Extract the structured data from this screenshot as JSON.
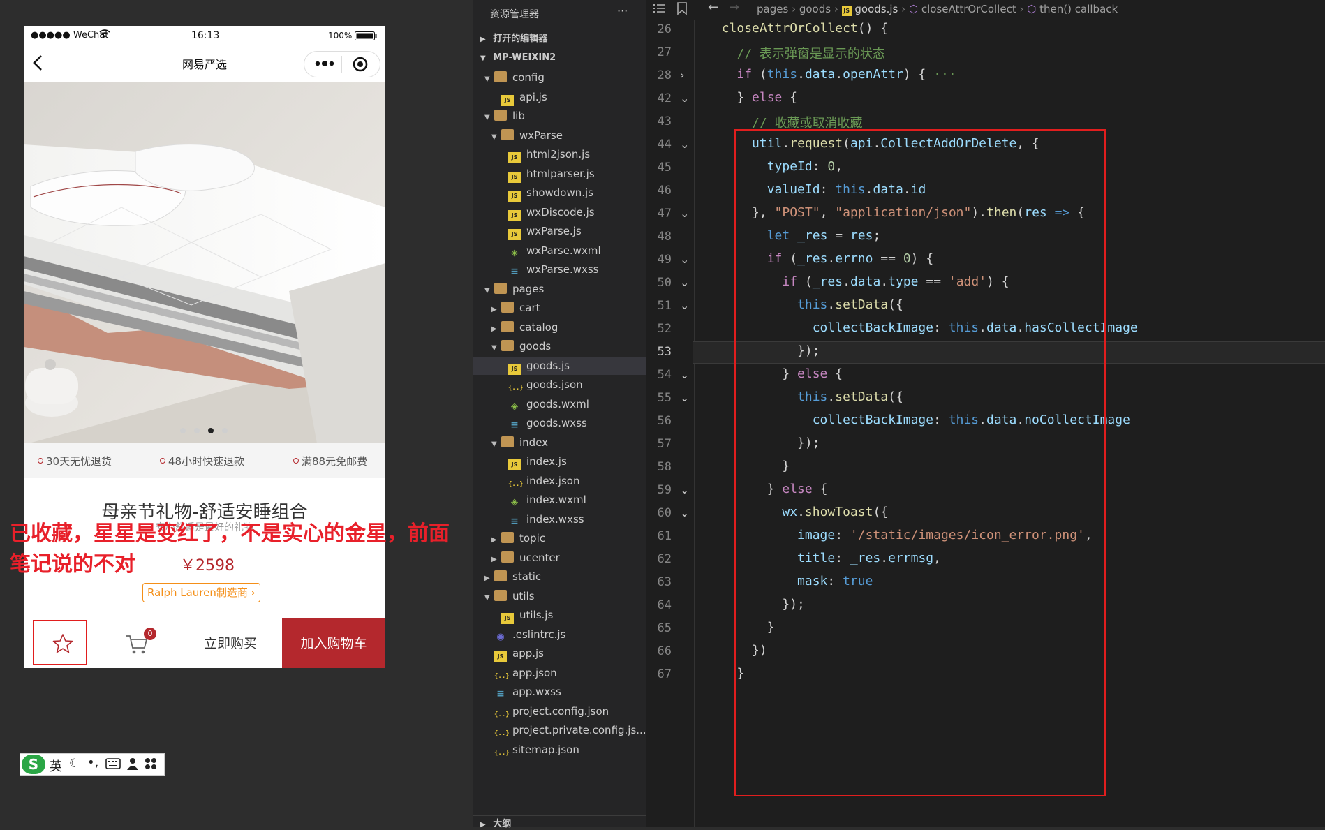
{
  "phone": {
    "carrier": "●●●●● WeChat",
    "time": "16:13",
    "battery": "100%",
    "nav_title": "网易严选",
    "services": [
      "30天无忧退货",
      "48小时快速退款",
      "满88元免邮费"
    ],
    "product_title": "母亲节礼物-舒适安睡组合",
    "product_subtitle": "安心舒适是最好的礼物",
    "price": "￥2598",
    "brand_tag": "Ralph Lauren制造商",
    "cart_badge": "0",
    "buy_now": "立即购买",
    "add_to_cart": "加入购物车",
    "carousel_active_index": 2
  },
  "annotation": {
    "line1": "已收藏，星星是变红了，不是实心的金星，前面",
    "line2": "笔记说的不对"
  },
  "ime_toolbar": {
    "lang": "英"
  },
  "explorer": {
    "header": "资源管理器",
    "more": "···",
    "open_editors": "打开的编辑器",
    "project": "MP-WEIXIN2",
    "outline": "大纲",
    "tree": [
      {
        "name": "config",
        "type": "folder",
        "depth": 1,
        "open": true
      },
      {
        "name": "api.js",
        "type": "js",
        "depth": 2
      },
      {
        "name": "lib",
        "type": "folder",
        "depth": 1,
        "open": true
      },
      {
        "name": "wxParse",
        "type": "folder",
        "depth": 2,
        "open": true
      },
      {
        "name": "html2json.js",
        "type": "js",
        "depth": 3
      },
      {
        "name": "htmlparser.js",
        "type": "js",
        "depth": 3
      },
      {
        "name": "showdown.js",
        "type": "js",
        "depth": 3
      },
      {
        "name": "wxDiscode.js",
        "type": "js",
        "depth": 3
      },
      {
        "name": "wxParse.js",
        "type": "js",
        "depth": 3
      },
      {
        "name": "wxParse.wxml",
        "type": "wxml",
        "depth": 3
      },
      {
        "name": "wxParse.wxss",
        "type": "css",
        "depth": 3
      },
      {
        "name": "pages",
        "type": "folder",
        "depth": 1,
        "open": true
      },
      {
        "name": "cart",
        "type": "folder",
        "depth": 2,
        "open": false
      },
      {
        "name": "catalog",
        "type": "folder",
        "depth": 2,
        "open": false
      },
      {
        "name": "goods",
        "type": "folder",
        "depth": 2,
        "open": true
      },
      {
        "name": "goods.js",
        "type": "js",
        "depth": 3,
        "selected": true
      },
      {
        "name": "goods.json",
        "type": "json",
        "depth": 3
      },
      {
        "name": "goods.wxml",
        "type": "wxml",
        "depth": 3
      },
      {
        "name": "goods.wxss",
        "type": "css",
        "depth": 3
      },
      {
        "name": "index",
        "type": "folder",
        "depth": 2,
        "open": true
      },
      {
        "name": "index.js",
        "type": "js",
        "depth": 3
      },
      {
        "name": "index.json",
        "type": "json",
        "depth": 3
      },
      {
        "name": "index.wxml",
        "type": "wxml",
        "depth": 3
      },
      {
        "name": "index.wxss",
        "type": "css",
        "depth": 3
      },
      {
        "name": "topic",
        "type": "folder",
        "depth": 2,
        "open": false
      },
      {
        "name": "ucenter",
        "type": "folder",
        "depth": 2,
        "open": false
      },
      {
        "name": "static",
        "type": "folder",
        "depth": 1,
        "open": false
      },
      {
        "name": "utils",
        "type": "folder",
        "depth": 1,
        "open": true
      },
      {
        "name": "utils.js",
        "type": "js",
        "depth": 2
      },
      {
        "name": ".eslintrc.js",
        "type": "eslint",
        "depth": 1
      },
      {
        "name": "app.js",
        "type": "js",
        "depth": 1
      },
      {
        "name": "app.json",
        "type": "json",
        "depth": 1
      },
      {
        "name": "app.wxss",
        "type": "css",
        "depth": 1
      },
      {
        "name": "project.config.json",
        "type": "json",
        "depth": 1
      },
      {
        "name": "project.private.config.js...",
        "type": "json",
        "depth": 1
      },
      {
        "name": "sitemap.json",
        "type": "json",
        "depth": 1
      }
    ]
  },
  "breadcrumb": [
    "pages",
    "goods",
    "goods.js",
    "closeAttrOrCollect",
    "then() callback"
  ],
  "code_lines": [
    {
      "n": "26",
      "fold": "",
      "t": [
        [
          "  ",
          ""
        ],
        [
          "closeAttrOrCollect",
          "fn"
        ],
        [
          "() {",
          ""
        ]
      ]
    },
    {
      "n": "27",
      "fold": "",
      "t": [
        [
          "    ",
          ""
        ],
        [
          "// 表示弹窗是显示的状态",
          "cm"
        ]
      ]
    },
    {
      "n": "28",
      "fold": ">",
      "t": [
        [
          "    ",
          ""
        ],
        [
          "if",
          "kw2"
        ],
        [
          " (",
          ""
        ],
        [
          "this",
          "kw"
        ],
        [
          ".",
          ""
        ],
        [
          "data",
          "pr"
        ],
        [
          ".",
          ""
        ],
        [
          "openAttr",
          "pr"
        ],
        [
          ") { ",
          ""
        ],
        [
          "···",
          "cm"
        ]
      ]
    },
    {
      "n": "42",
      "fold": "v",
      "t": [
        [
          "    } ",
          ""
        ],
        [
          "else",
          "kw2"
        ],
        [
          " {",
          ""
        ]
      ]
    },
    {
      "n": "43",
      "fold": "",
      "t": [
        [
          "      ",
          ""
        ],
        [
          "// 收藏或取消收藏",
          "cm"
        ]
      ]
    },
    {
      "n": "44",
      "fold": "v",
      "t": [
        [
          "      ",
          ""
        ],
        [
          "util",
          "pr"
        ],
        [
          ".",
          ""
        ],
        [
          "request",
          "fn"
        ],
        [
          "(",
          ""
        ],
        [
          "api",
          "pr"
        ],
        [
          ".",
          ""
        ],
        [
          "CollectAddOrDelete",
          "pr"
        ],
        [
          ", {",
          ""
        ]
      ]
    },
    {
      "n": "45",
      "fold": "",
      "t": [
        [
          "        ",
          ""
        ],
        [
          "typeId",
          "pr"
        ],
        [
          ": ",
          ""
        ],
        [
          "0",
          "nm"
        ],
        [
          ",",
          ""
        ]
      ]
    },
    {
      "n": "46",
      "fold": "",
      "t": [
        [
          "        ",
          ""
        ],
        [
          "valueId",
          "pr"
        ],
        [
          ": ",
          ""
        ],
        [
          "this",
          "kw"
        ],
        [
          ".",
          ""
        ],
        [
          "data",
          "pr"
        ],
        [
          ".",
          ""
        ],
        [
          "id",
          "pr"
        ]
      ]
    },
    {
      "n": "47",
      "fold": "v",
      "t": [
        [
          "      }, ",
          ""
        ],
        [
          "\"POST\"",
          "st"
        ],
        [
          ", ",
          ""
        ],
        [
          "\"application/json\"",
          "st"
        ],
        [
          ").",
          ""
        ],
        [
          "then",
          "fn"
        ],
        [
          "(",
          ""
        ],
        [
          "res",
          "pr"
        ],
        [
          " ",
          ""
        ],
        [
          "=>",
          "kw"
        ],
        [
          " {",
          ""
        ]
      ]
    },
    {
      "n": "48",
      "fold": "",
      "t": [
        [
          "        ",
          ""
        ],
        [
          "let",
          "kw"
        ],
        [
          " ",
          ""
        ],
        [
          "_res",
          "pr"
        ],
        [
          " = ",
          ""
        ],
        [
          "res",
          "pr"
        ],
        [
          ";",
          ""
        ]
      ]
    },
    {
      "n": "49",
      "fold": "v",
      "t": [
        [
          "        ",
          ""
        ],
        [
          "if",
          "kw2"
        ],
        [
          " (",
          ""
        ],
        [
          "_res",
          "pr"
        ],
        [
          ".",
          ""
        ],
        [
          "errno",
          "pr"
        ],
        [
          " == ",
          ""
        ],
        [
          "0",
          "nm"
        ],
        [
          ") {",
          ""
        ]
      ]
    },
    {
      "n": "50",
      "fold": "v",
      "t": [
        [
          "          ",
          ""
        ],
        [
          "if",
          "kw2"
        ],
        [
          " (",
          ""
        ],
        [
          "_res",
          "pr"
        ],
        [
          ".",
          ""
        ],
        [
          "data",
          "pr"
        ],
        [
          ".",
          ""
        ],
        [
          "type",
          "pr"
        ],
        [
          " == ",
          ""
        ],
        [
          "'add'",
          "st"
        ],
        [
          ") {",
          ""
        ]
      ]
    },
    {
      "n": "51",
      "fold": "v",
      "t": [
        [
          "            ",
          ""
        ],
        [
          "this",
          "kw"
        ],
        [
          ".",
          ""
        ],
        [
          "setData",
          "fn"
        ],
        [
          "({",
          ""
        ]
      ]
    },
    {
      "n": "52",
      "fold": "",
      "t": [
        [
          "              ",
          ""
        ],
        [
          "collectBackImage",
          "pr"
        ],
        [
          ": ",
          ""
        ],
        [
          "this",
          "kw"
        ],
        [
          ".",
          ""
        ],
        [
          "data",
          "pr"
        ],
        [
          ".",
          ""
        ],
        [
          "hasCollectImage",
          "pr"
        ]
      ]
    },
    {
      "n": "53",
      "fold": "",
      "t": [
        [
          "            });",
          ""
        ]
      ],
      "current": true
    },
    {
      "n": "54",
      "fold": "v",
      "t": [
        [
          "          } ",
          ""
        ],
        [
          "else",
          "kw2"
        ],
        [
          " {",
          ""
        ]
      ]
    },
    {
      "n": "55",
      "fold": "v",
      "t": [
        [
          "            ",
          ""
        ],
        [
          "this",
          "kw"
        ],
        [
          ".",
          ""
        ],
        [
          "setData",
          "fn"
        ],
        [
          "({",
          ""
        ]
      ]
    },
    {
      "n": "56",
      "fold": "",
      "t": [
        [
          "              ",
          ""
        ],
        [
          "collectBackImage",
          "pr"
        ],
        [
          ": ",
          ""
        ],
        [
          "this",
          "kw"
        ],
        [
          ".",
          ""
        ],
        [
          "data",
          "pr"
        ],
        [
          ".",
          ""
        ],
        [
          "noCollectImage",
          "pr"
        ]
      ]
    },
    {
      "n": "57",
      "fold": "",
      "t": [
        [
          "            });",
          ""
        ]
      ]
    },
    {
      "n": "58",
      "fold": "",
      "t": [
        [
          "          }",
          ""
        ]
      ]
    },
    {
      "n": "59",
      "fold": "v",
      "t": [
        [
          "        } ",
          ""
        ],
        [
          "else",
          "kw2"
        ],
        [
          " {",
          ""
        ]
      ]
    },
    {
      "n": "60",
      "fold": "v",
      "t": [
        [
          "          ",
          ""
        ],
        [
          "wx",
          "pr"
        ],
        [
          ".",
          ""
        ],
        [
          "showToast",
          "fn"
        ],
        [
          "({",
          ""
        ]
      ]
    },
    {
      "n": "61",
      "fold": "",
      "t": [
        [
          "            ",
          ""
        ],
        [
          "image",
          "pr"
        ],
        [
          ": ",
          ""
        ],
        [
          "'/static/images/icon_error.png'",
          "st"
        ],
        [
          ",",
          ""
        ]
      ]
    },
    {
      "n": "62",
      "fold": "",
      "t": [
        [
          "            ",
          ""
        ],
        [
          "title",
          "pr"
        ],
        [
          ": ",
          ""
        ],
        [
          "_res",
          "pr"
        ],
        [
          ".",
          ""
        ],
        [
          "errmsg",
          "pr"
        ],
        [
          ",",
          ""
        ]
      ]
    },
    {
      "n": "63",
      "fold": "",
      "t": [
        [
          "            ",
          ""
        ],
        [
          "mask",
          "pr"
        ],
        [
          ": ",
          ""
        ],
        [
          "true",
          "kw"
        ]
      ]
    },
    {
      "n": "64",
      "fold": "",
      "t": [
        [
          "          });",
          ""
        ]
      ]
    },
    {
      "n": "65",
      "fold": "",
      "t": [
        [
          "        }",
          ""
        ]
      ]
    },
    {
      "n": "66",
      "fold": "",
      "t": [
        [
          "      })",
          ""
        ]
      ]
    },
    {
      "n": "67",
      "fold": "",
      "t": [
        [
          "    }",
          ""
        ]
      ]
    }
  ],
  "colors": {
    "accent_red": "#b4282d",
    "annotation_red": "#e8202a",
    "highlight_box": "#e11e1e"
  }
}
